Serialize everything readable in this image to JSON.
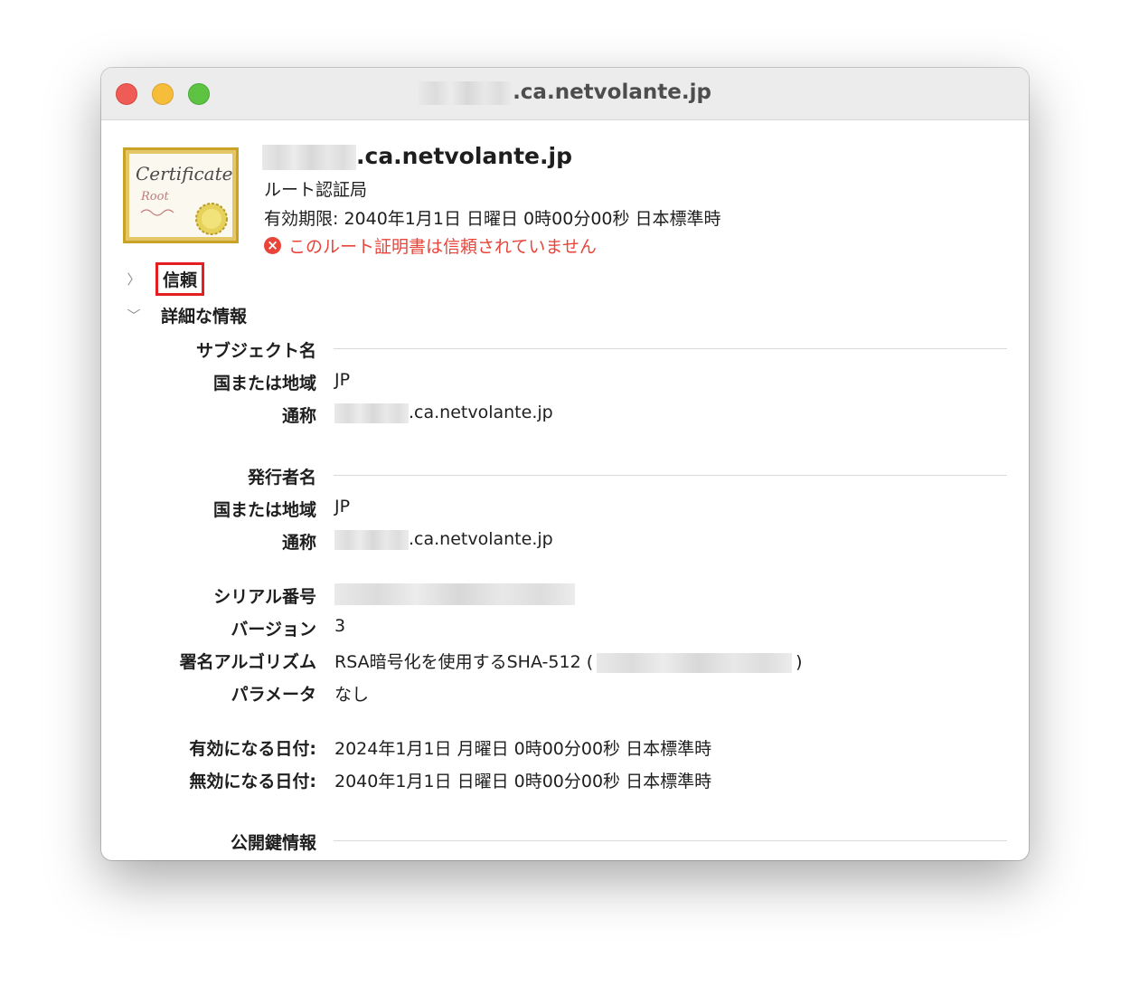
{
  "window": {
    "title_suffix": ".ca.netvolante.jp"
  },
  "certificate": {
    "name_suffix": ".ca.netvolante.jp",
    "type": "ルート認証局",
    "expiry": "有効期限: 2040年1月1日 日曜日 0時00分00秒 日本標準時",
    "warning": "このルート証明書は信頼されていません",
    "icon_text": "Certificate",
    "icon_sub": "Root"
  },
  "sections": {
    "trust": "信頼",
    "details": "詳細な情報"
  },
  "details": {
    "subject_header": "サブジェクト名",
    "subject_country_label": "国または地域",
    "subject_country_value": "JP",
    "subject_cn_label": "通称",
    "subject_cn_suffix": ".ca.netvolante.jp",
    "issuer_header": "発行者名",
    "issuer_country_label": "国または地域",
    "issuer_country_value": "JP",
    "issuer_cn_label": "通称",
    "issuer_cn_suffix": ".ca.netvolante.jp",
    "serial_label": "シリアル番号",
    "version_label": "バージョン",
    "version_value": "3",
    "sigalg_label": "署名アルゴリズム",
    "sigalg_value": "RSA暗号化を使用するSHA-512 (",
    "sigalg_close": ")",
    "params_label": "パラメータ",
    "params_value": "なし",
    "not_before_label": "有効になる日付:",
    "not_before_value": "2024年1月1日 月曜日 0時00分00秒 日本標準時",
    "not_after_label": "無効になる日付:",
    "not_after_value": "2040年1月1日 日曜日 0時00分00秒 日本標準時",
    "pubkey_header": "公開鍵情報"
  },
  "colors": {
    "warning": "#e8443a",
    "highlight_border": "#e51f1f",
    "certificate_gold": "#c9a227"
  }
}
